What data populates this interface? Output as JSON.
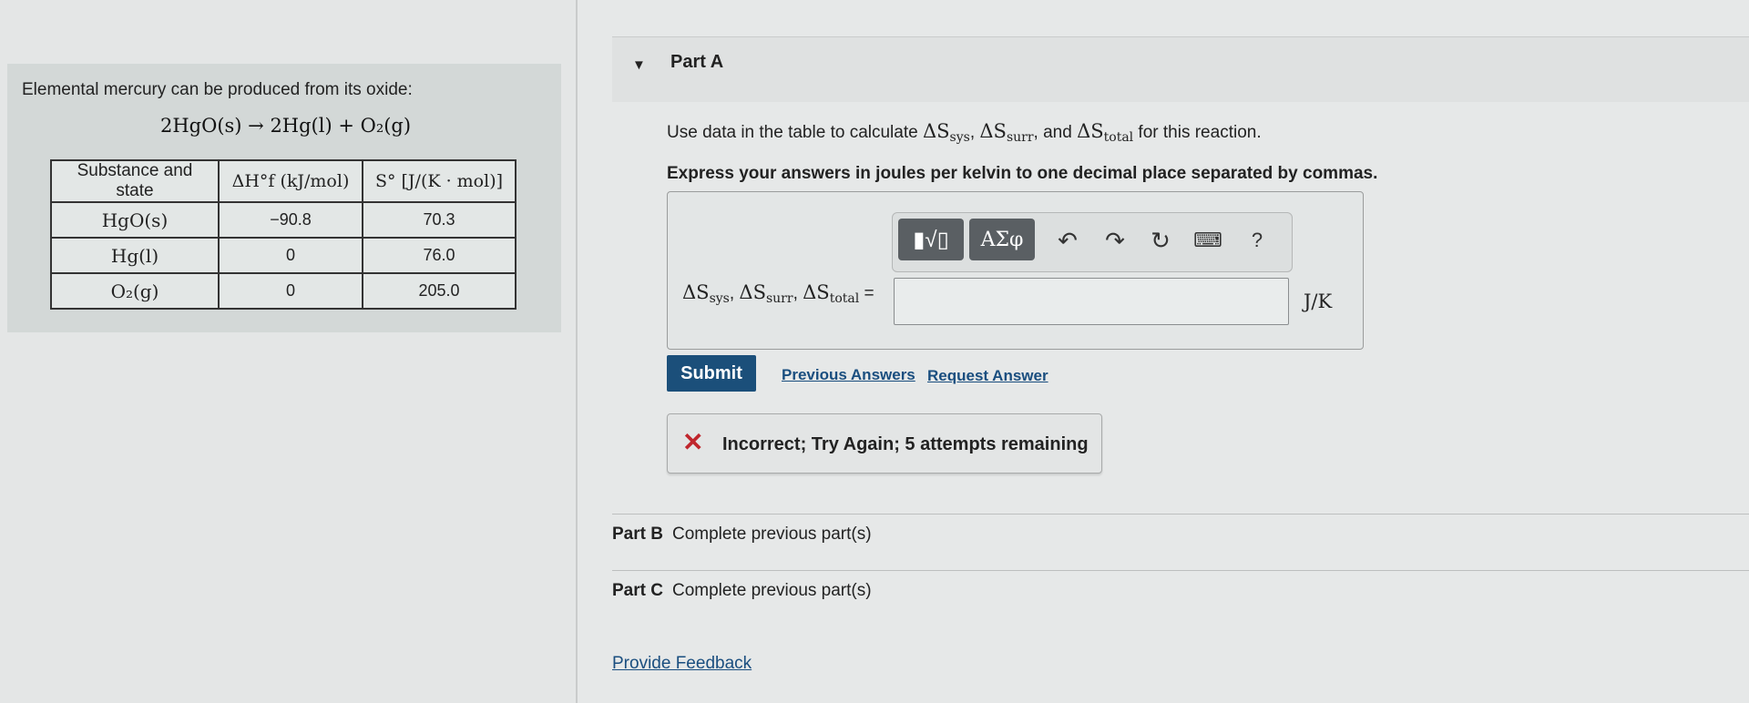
{
  "problem": {
    "intro": "Elemental mercury can be produced from its oxide:",
    "equation": "2HgO(s) → 2Hg(l) + O₂(g)",
    "table": {
      "headers": [
        "Substance and state",
        "ΔH°f (kJ/mol)",
        "S° [J/(K · mol)]"
      ],
      "rows": [
        {
          "substance": "HgO(s)",
          "dH": "−90.8",
          "S": "70.3"
        },
        {
          "substance": "Hg(l)",
          "dH": "0",
          "S": "76.0"
        },
        {
          "substance": "O₂(g)",
          "dH": "0",
          "S": "205.0"
        }
      ]
    }
  },
  "part_a": {
    "title": "Part A",
    "question": {
      "prefix": "Use data in the table to calculate ",
      "s1": "ΔS",
      "s1_sub": "sys",
      "s2": "ΔS",
      "s2_sub": "surr",
      "and": ", and ",
      "s3": "ΔS",
      "s3_sub": "total",
      "suffix": " for this reaction."
    },
    "instruction": "Express your answers in joules per kelvin to one decimal place separated by commas.",
    "toolbar": {
      "templates_icon": "templates-icon",
      "symbols_label": "ΑΣφ",
      "undo_icon": "undo-icon",
      "redo_icon": "redo-icon",
      "reset_icon": "reset-icon",
      "keyboard_icon": "keyboard-icon",
      "help_label": "?"
    },
    "answer": {
      "label_var": "ΔS",
      "label_sub1": "sys",
      "label_sub2": "surr",
      "label_sub3": "total",
      "value": "",
      "unit": "J/K"
    },
    "submit_label": "Submit",
    "previous_answers_label": "Previous Answers",
    "request_answer_label": "Request Answer",
    "feedback": {
      "icon": "x-icon",
      "text": "Incorrect; Try Again; 5 attempts remaining"
    }
  },
  "part_b": {
    "label": "Part B",
    "status": "Complete previous part(s)"
  },
  "part_c": {
    "label": "Part C",
    "status": "Complete previous part(s)"
  },
  "provide_feedback_label": "Provide Feedback",
  "colors": {
    "accent": "#1b4f7a",
    "link": "#1a4e7f",
    "error": "#c0262d"
  }
}
